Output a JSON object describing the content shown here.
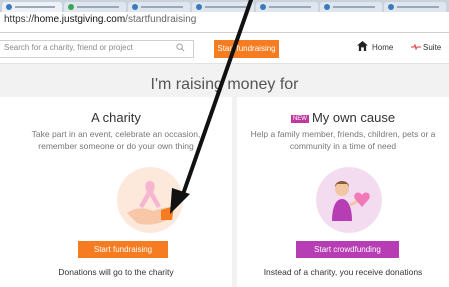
{
  "browser": {
    "url_host": "home.justgiving.com",
    "url_prefix": "https://",
    "url_path": "/startfundraising"
  },
  "header": {
    "search_placeholder": "Search for a charity, friend or project",
    "start_fundraising_label": "Start fundraising",
    "home_label": "Home",
    "pulse_label": "Suite"
  },
  "main": {
    "heading": "I'm raising money for",
    "charity_card": {
      "title": "A charity",
      "description": "Take part in an event, celebrate an occasion, remember someone or do your own thing",
      "button": "Start fundraising",
      "footer": "Donations will go to the charity"
    },
    "cause_card": {
      "badge": "NEW",
      "title": "My own cause",
      "description": "Help a family member, friends, children, pets or a community in a time of need",
      "button": "Start crowdfunding",
      "footer": "Instead of a charity, you receive donations"
    }
  },
  "colors": {
    "accent_orange": "#f57c21",
    "accent_purple": "#b63db3"
  }
}
